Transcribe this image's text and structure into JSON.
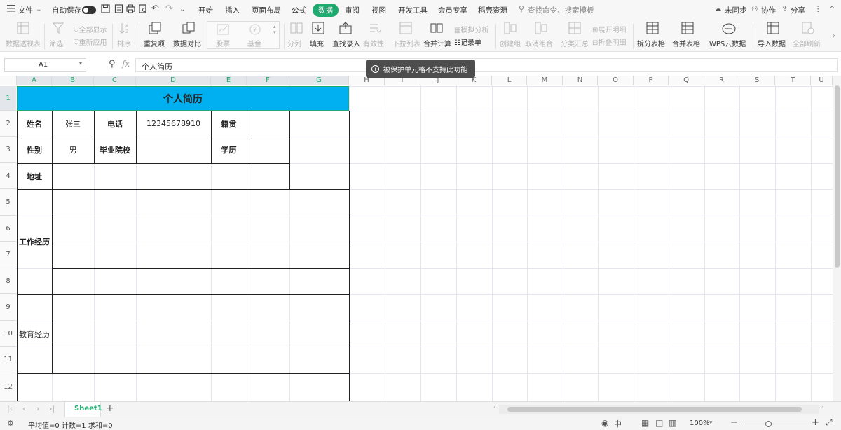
{
  "menu": {
    "hamburger_icon": "menu-icon",
    "file": "文件",
    "autosave": "自动保存",
    "tabs": [
      "开始",
      "插入",
      "页面布局",
      "公式",
      "数据",
      "审阅",
      "视图",
      "开发工具",
      "会员专享",
      "稻壳资源"
    ],
    "active_tab": "数据",
    "search_placeholder": "查找命令、搜索模板",
    "sync": "未同步",
    "collab": "协作",
    "share": "分享"
  },
  "ribbon": {
    "pivot": "数据透视表",
    "filter": "筛选",
    "show_all": "全部显示",
    "reapply": "重新应用",
    "sort": "排序",
    "dup": "重复项",
    "compare": "数据对比",
    "stock": "股票",
    "fund": "基金",
    "split_col": "分列",
    "fill": "填充",
    "lookup": "查找录入",
    "validity": "有效性",
    "dropdown": "下拉列表",
    "consolidate": "合并计算",
    "whatif": "模拟分析",
    "record": "记录单",
    "group": "创建组",
    "ungroup": "取消组合",
    "subtotal": "分类汇总",
    "expand": "展开明细",
    "collapse": "折叠明细",
    "split_table": "拆分表格",
    "merge_table": "合并表格",
    "wps_cloud": "WPS云数据",
    "import": "导入数据",
    "refresh": "全部刷新"
  },
  "formula": {
    "cell_ref": "A1",
    "fx": "fx",
    "content": "个人简历"
  },
  "tooltip": "被保护单元格不支持此功能",
  "columns": [
    "A",
    "B",
    "C",
    "D",
    "E",
    "F",
    "G",
    "H",
    "I",
    "J",
    "K",
    "L",
    "M",
    "N",
    "O",
    "P",
    "Q",
    "R",
    "S",
    "T",
    "U"
  ],
  "rows": [
    "1",
    "2",
    "3",
    "4",
    "5",
    "6",
    "7",
    "8",
    "9",
    "10",
    "11",
    "12"
  ],
  "sheet": {
    "title": "个人简历",
    "name_label": "姓名",
    "name_value": "张三",
    "phone_label": "电话",
    "phone_value": "12345678910",
    "origin_label": "籍贯",
    "gender_label": "性别",
    "gender_value": "男",
    "school_label": "毕业院校",
    "edu_label": "学历",
    "address_label": "地址",
    "work_label": "工作经历",
    "education_label": "教育经历"
  },
  "tabs": {
    "sheet1": "Sheet1",
    "add": "+"
  },
  "status": {
    "summary": "平均值=0  计数=1  求和=0",
    "zoom": "100%"
  },
  "colors": {
    "accent": "#1ea96e",
    "title_fill": "#00b0f0"
  }
}
